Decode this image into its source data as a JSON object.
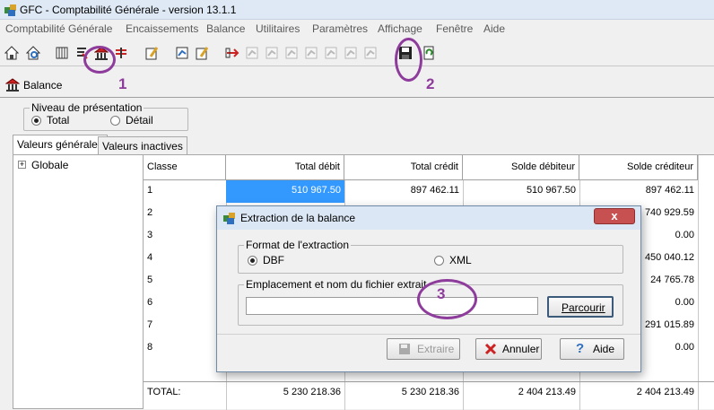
{
  "window": {
    "title": "GFC - Comptabilité Générale - version 13.1.1"
  },
  "menu": {
    "items": [
      "Comptabilité Générale",
      "Encaissements",
      "Balance",
      "Utilitaires",
      "Paramètres",
      "Affichage",
      "Fenêtre",
      "Aide"
    ]
  },
  "panel": {
    "title": "Balance"
  },
  "presentation": {
    "group_title": "Niveau de présentation",
    "options": [
      "Total",
      "Détail"
    ],
    "selected": "Total"
  },
  "tabs": [
    "Valeurs générales",
    "Valeurs inactives"
  ],
  "tree": {
    "root": "Globale"
  },
  "grid": {
    "columns": [
      "Classe",
      "Total débit",
      "Total crédit",
      "Solde débiteur",
      "Solde créditeur"
    ],
    "rows": [
      [
        "1",
        "510 967.50",
        "897 462.11",
        "510 967.50",
        "897 462.11"
      ],
      [
        "2",
        "",
        "",
        "",
        "740 929.59"
      ],
      [
        "3",
        "",
        "",
        "",
        "0.00"
      ],
      [
        "4",
        "",
        "",
        "",
        "450 040.12"
      ],
      [
        "5",
        "",
        "",
        "",
        "24 765.78"
      ],
      [
        "6",
        "",
        "",
        "",
        "0.00"
      ],
      [
        "7",
        "",
        "",
        "",
        "291 015.89"
      ],
      [
        "8",
        "",
        "",
        "",
        "0.00"
      ]
    ],
    "total": [
      "TOTAL:",
      "5 230 218.36",
      "5 230 218.36",
      "2 404 213.49",
      "2 404 213.49"
    ]
  },
  "dialog": {
    "title": "Extraction de la balance",
    "close": "x",
    "format_group": "Format de l'extraction",
    "format_options": [
      "DBF",
      "XML"
    ],
    "format_selected": "DBF",
    "path_group": "Emplacement et nom du fichier extrait",
    "path_value": "",
    "browse": "Parcourir",
    "extract": "Extraire",
    "cancel": "Annuler",
    "help": "Aide"
  },
  "annotations": [
    "1",
    "2",
    "3"
  ],
  "colors": {
    "annotation": "#8e3c9c",
    "selection": "#3399ff",
    "close_button": "#c75050"
  }
}
